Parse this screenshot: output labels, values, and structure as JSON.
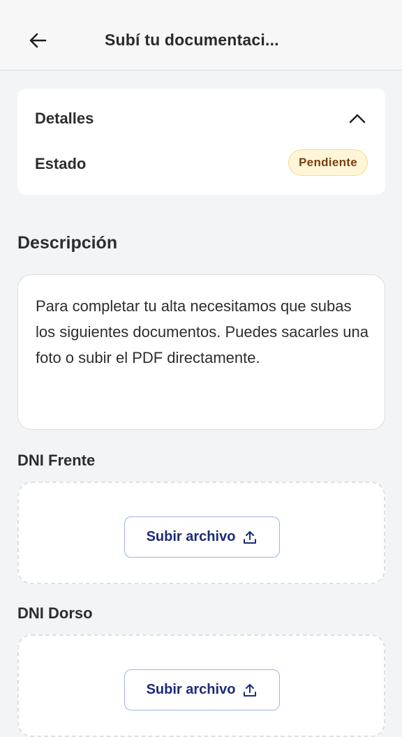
{
  "header": {
    "title": "Subí tu documentaci...",
    "back_icon": "arrow-left-icon"
  },
  "details": {
    "title": "Detalles",
    "collapse_icon": "chevron-up-icon",
    "status_label": "Estado",
    "status_value": "Pendiente",
    "status_color": "#7a3d12",
    "status_bg": "#fff6d8"
  },
  "description": {
    "title": "Descripción",
    "text": "Para completar tu alta necesitamos que subas los siguientes documentos. Puedes sacarles una foto o subir el PDF directamente."
  },
  "documents": [
    {
      "label": "DNI Frente",
      "button_label": "Subir archivo",
      "button_icon": "upload-icon"
    },
    {
      "label": "DNI Dorso",
      "button_label": "Subir archivo",
      "button_icon": "upload-icon"
    }
  ],
  "colors": {
    "accent": "#1c2a7a",
    "button_border": "#9fb3e6",
    "background": "#f3f4f6"
  }
}
